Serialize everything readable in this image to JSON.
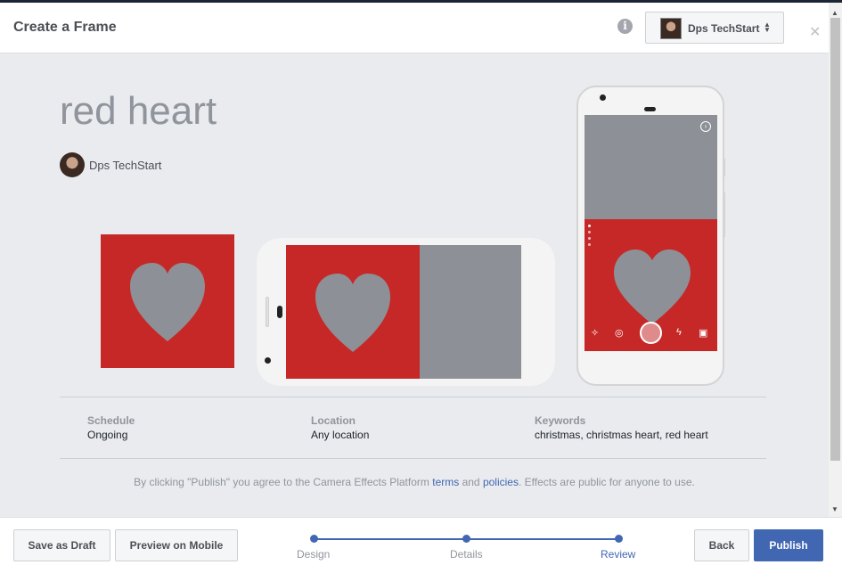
{
  "dialog": {
    "title": "Create a Frame",
    "account_name": "Dps TechStart",
    "info_icon": "info-icon",
    "close_icon": "close-icon"
  },
  "effect": {
    "name": "red heart",
    "owner": "Dps TechStart"
  },
  "details": {
    "schedule_label": "Schedule",
    "schedule_value": "Ongoing",
    "location_label": "Location",
    "location_value": "Any location",
    "keywords_label": "Keywords",
    "keywords_value": "christmas, christmas heart, red heart"
  },
  "consent": {
    "prefix": "By clicking \"Publish\" you agree to the Camera Effects Platform ",
    "terms_link": "terms",
    "middle": " and ",
    "policies_link": "policies",
    "suffix": ". Effects are public for anyone to use."
  },
  "footer": {
    "save_draft": "Save as Draft",
    "preview_mobile": "Preview on Mobile",
    "back": "Back",
    "publish": "Publish",
    "steps": [
      "Design",
      "Details",
      "Review"
    ],
    "active_step": "Review"
  },
  "colors": {
    "frame_red": "#c62828",
    "heart_grey": "#8d9096",
    "accent": "#4267b2"
  }
}
